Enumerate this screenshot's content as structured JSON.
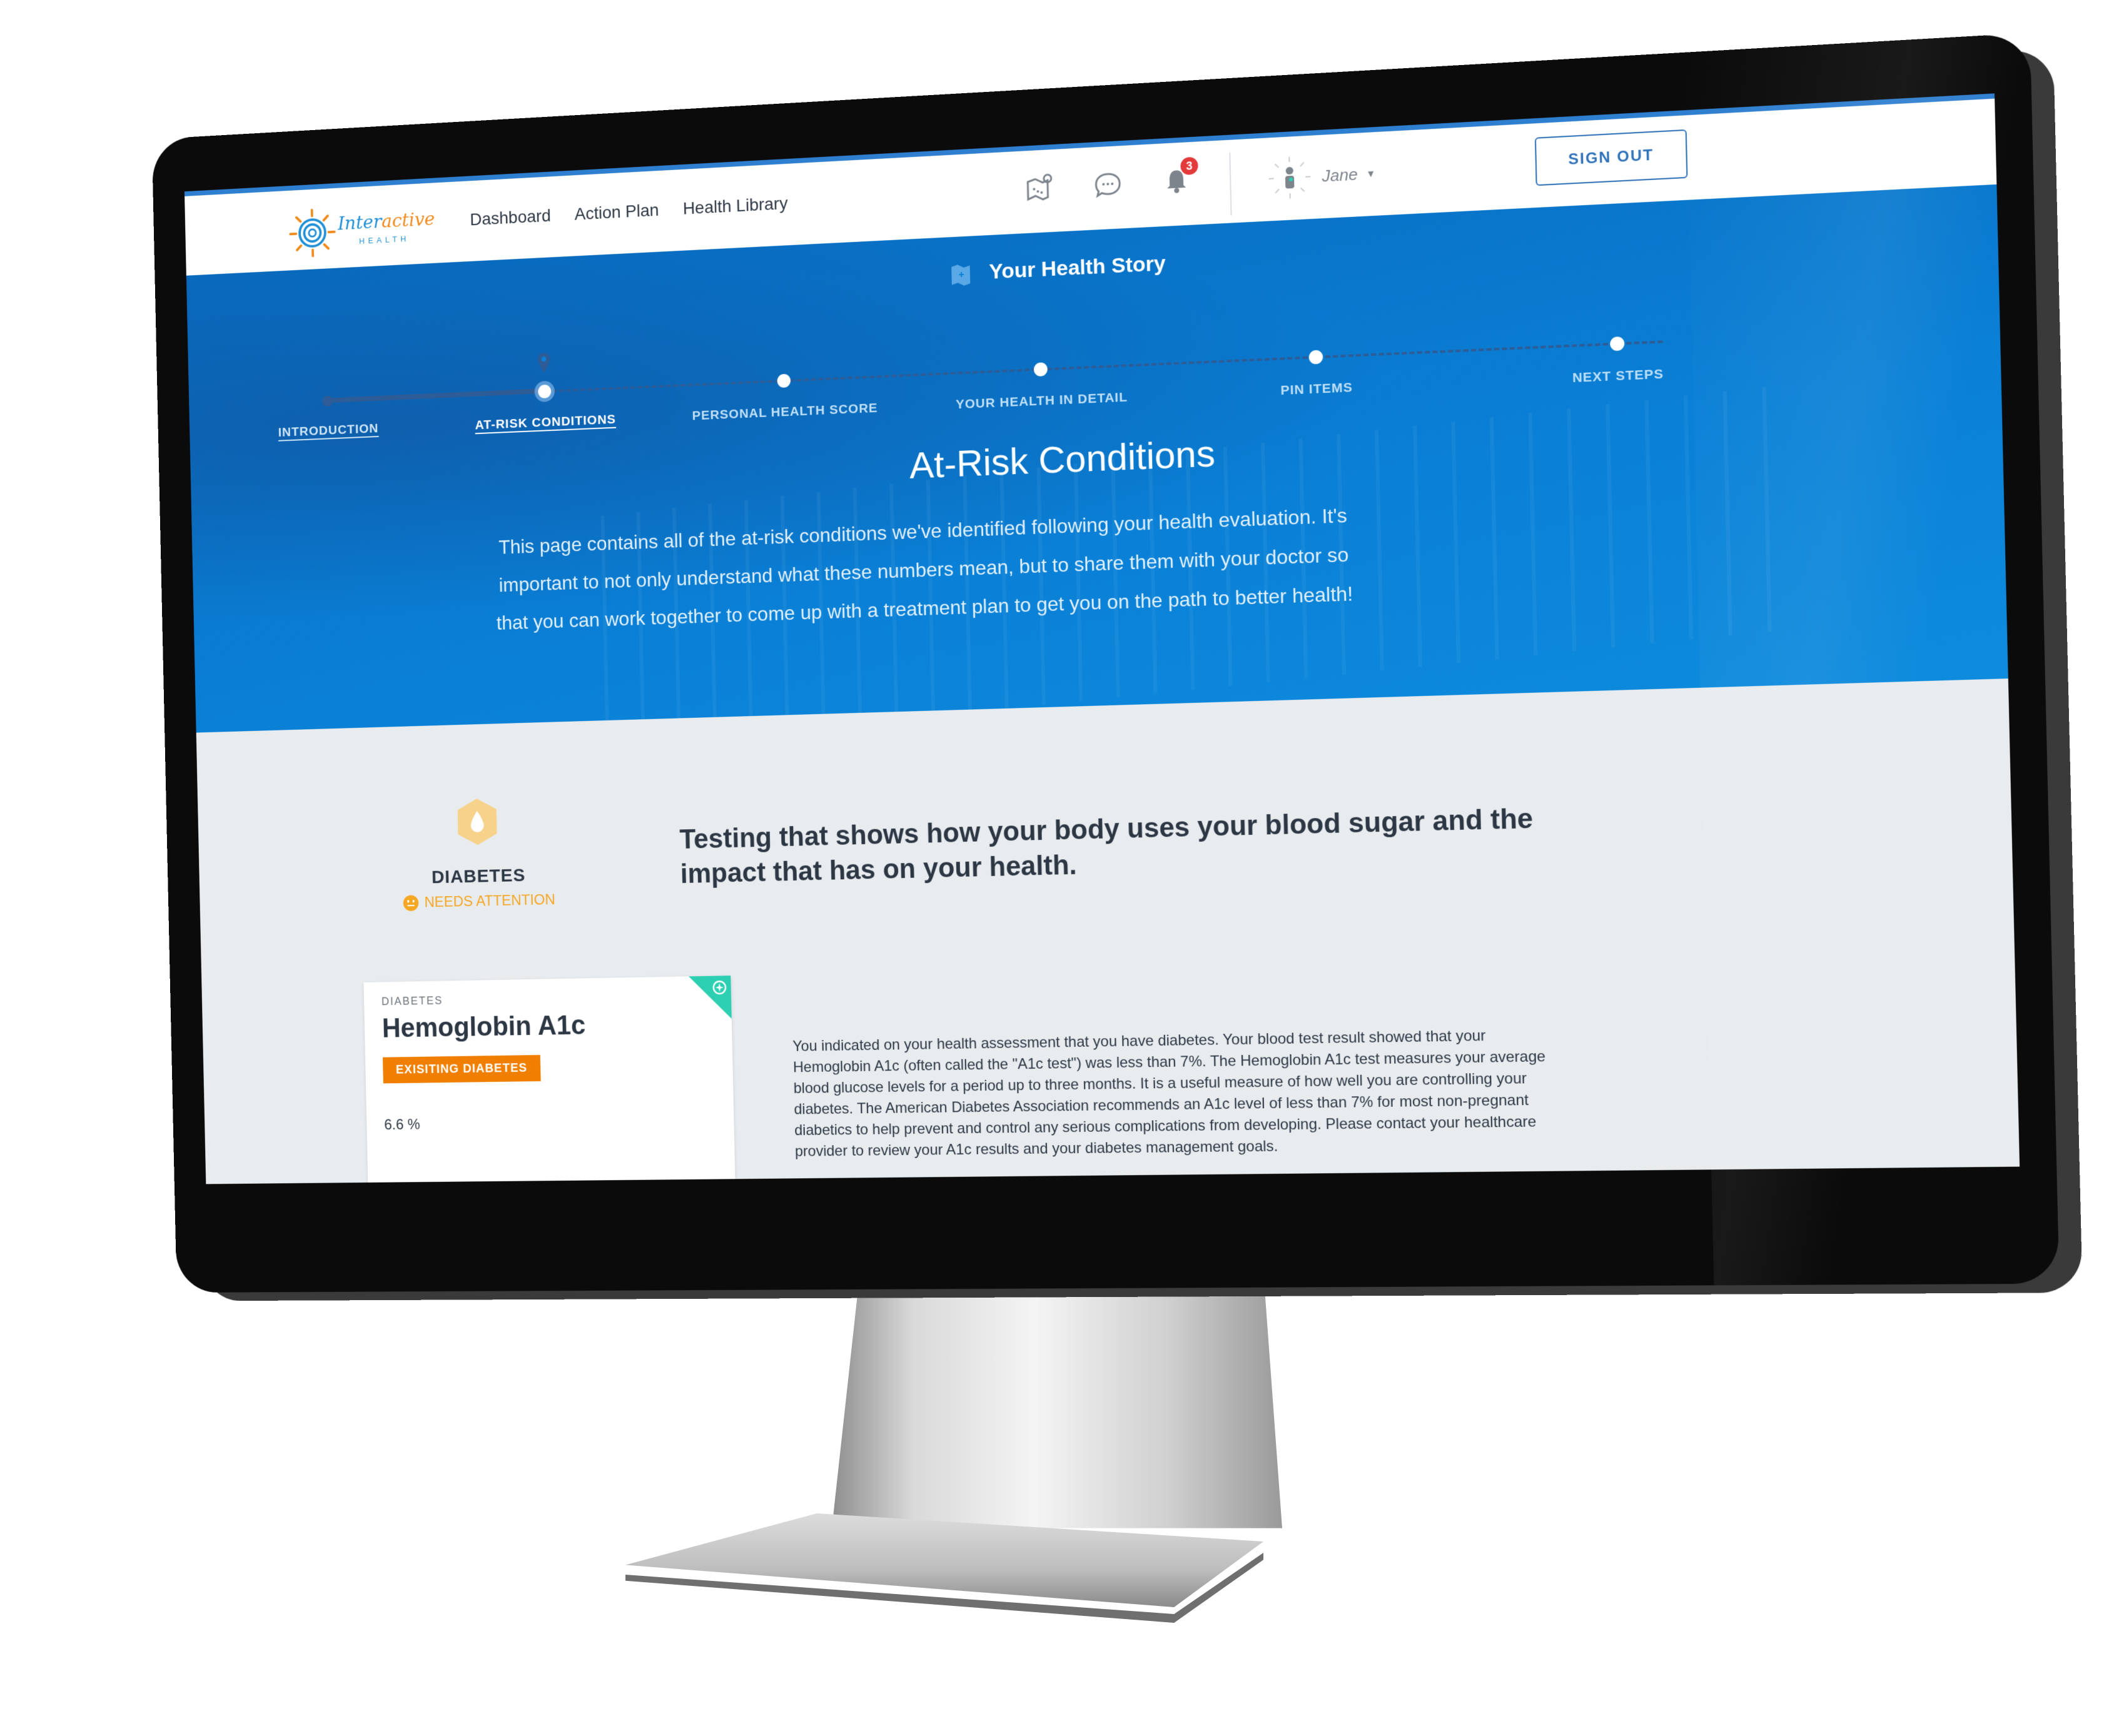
{
  "header": {
    "logo": {
      "word_inter": "Inter",
      "word_active": "active",
      "sub": "HEALTH"
    },
    "nav": [
      {
        "label": "Dashboard"
      },
      {
        "label": "Action Plan"
      },
      {
        "label": "Health Library"
      }
    ],
    "icons": [
      {
        "name": "map-pin-icon"
      },
      {
        "name": "chat-bubble-icon"
      },
      {
        "name": "bell-icon",
        "badge": "3"
      }
    ],
    "user": {
      "name": "Jane",
      "caret": "▾"
    },
    "sign_out_label": "SIGN OUT"
  },
  "hero": {
    "story_title": "Your Health Story",
    "steps": [
      {
        "label": "INTRODUCTION",
        "state": "completed"
      },
      {
        "label": "AT-RISK CONDITIONS",
        "state": "current"
      },
      {
        "label": "PERSONAL HEALTH SCORE",
        "state": "upcoming"
      },
      {
        "label": "YOUR HEALTH IN DETAIL",
        "state": "upcoming"
      },
      {
        "label": "PIN ITEMS",
        "state": "upcoming"
      },
      {
        "label": "NEXT STEPS",
        "state": "upcoming"
      }
    ],
    "heading": "At-Risk Conditions",
    "body": "This page contains all of the at-risk conditions we've identified following your health evaluation. It's important to not only understand what these numbers mean, but to share them with your doctor so that you can work together to come up with a treatment plan to get you on the path to better health!"
  },
  "condition": {
    "name": "DIABETES",
    "status": "NEEDS ATTENTION",
    "description": "Testing that shows how your body uses your blood sugar and the impact that has on your health.",
    "colors": {
      "status": "#f5a623",
      "hex_icon": "#f7d28a"
    }
  },
  "card": {
    "category": "DIABETES",
    "title": "Hemoglobin A1c",
    "tag": "EXISITING DIABETES",
    "value": "6.6 %",
    "colors": {
      "tag": "#f07e00",
      "corner": "#2ccfb1"
    }
  },
  "detail_paragraph": "You indicated on your health assessment that you have diabetes. Your blood test result showed that your Hemoglobin A1c (often called the \"A1c test\") was less than 7%. The Hemoglobin A1c test measures your average blood glucose levels for a period up to three months. It is a useful measure of how well you are controlling your diabetes. The American Diabetes Association recommends an A1c level of less than 7% for most non-pregnant diabetics to help prevent and control any serious complications from developing. Please contact your healthcare provider to review your A1c results and your diabetes management goals."
}
